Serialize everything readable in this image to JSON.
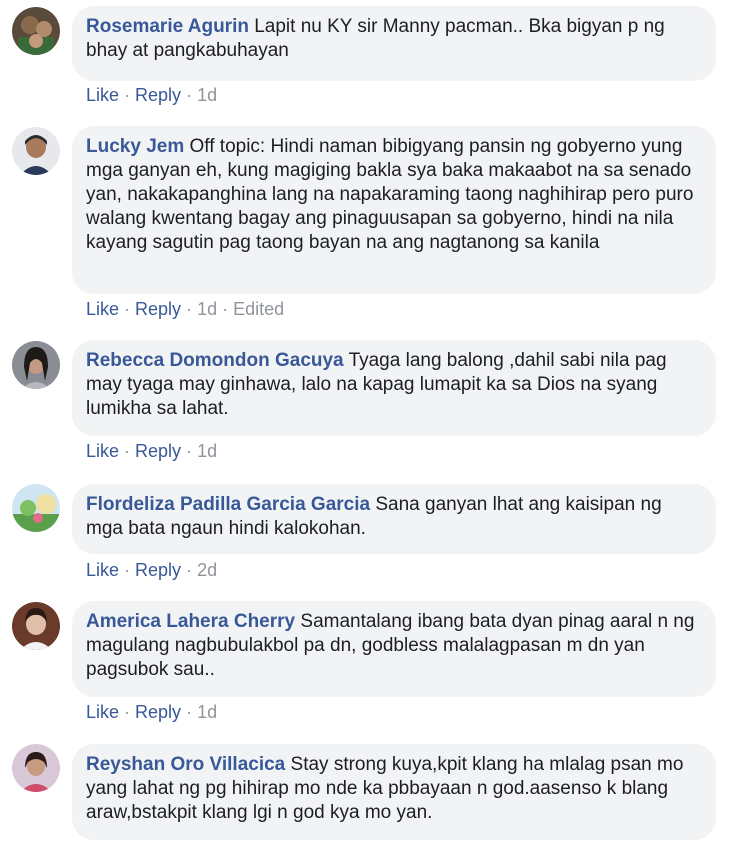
{
  "comments": [
    {
      "author": "Rosemarie Agurin",
      "text": "Lapit nu KY sir Manny pacman.. Bka bigyan p ng bhay at pangkabuhayan",
      "like": "Like",
      "reply": "Reply",
      "time": "1d",
      "edited": ""
    },
    {
      "author": "Lucky Jem",
      "text": "Off topic: Hindi naman bibigyang pansin ng gobyerno yung mga ganyan eh, kung magiging bakla sya baka makaabot na sa senado yan, nakakapanghina lang na napakaraming taong naghihirap pero puro walang kwentang bagay ang pinaguusapan sa gobyerno, hindi na nila kayang sagutin pag taong bayan na ang nagtanong sa kanila",
      "like": "Like",
      "reply": "Reply",
      "time": "1d",
      "edited": "Edited"
    },
    {
      "author": "Rebecca Domondon Gacuya",
      "text": "Tyaga lang balong ,dahil sabi nila pag may tyaga may ginhawa, lalo na kapag lumapit ka sa Dios na syang lumikha sa lahat.",
      "like": "Like",
      "reply": "Reply",
      "time": "1d",
      "edited": ""
    },
    {
      "author": "Flordeliza Padilla Garcia Garcia",
      "text": "Sana ganyan lhat ang kaisipan ng mga bata ngaun hindi kalokohan.",
      "like": "Like",
      "reply": "Reply",
      "time": "2d",
      "edited": ""
    },
    {
      "author": "America Lahera Cherry",
      "text": "Samantalang ibang bata dyan pinag aaral n ng magulang nagbubulakbol pa dn, godbless malalagpasan m dn yan pagsubok sau..",
      "like": "Like",
      "reply": "Reply",
      "time": "1d",
      "edited": ""
    },
    {
      "author": "Reyshan Oro Villacica",
      "text": "Stay strong kuya,kpit klang ha mlalag psan mo yang lahat ng pg hihirap mo nde ka pbbayaan n god.aasenso k blang araw,bstakpit klang lgi n god kya mo yan.",
      "like": "",
      "reply": "",
      "time": "",
      "edited": ""
    }
  ]
}
